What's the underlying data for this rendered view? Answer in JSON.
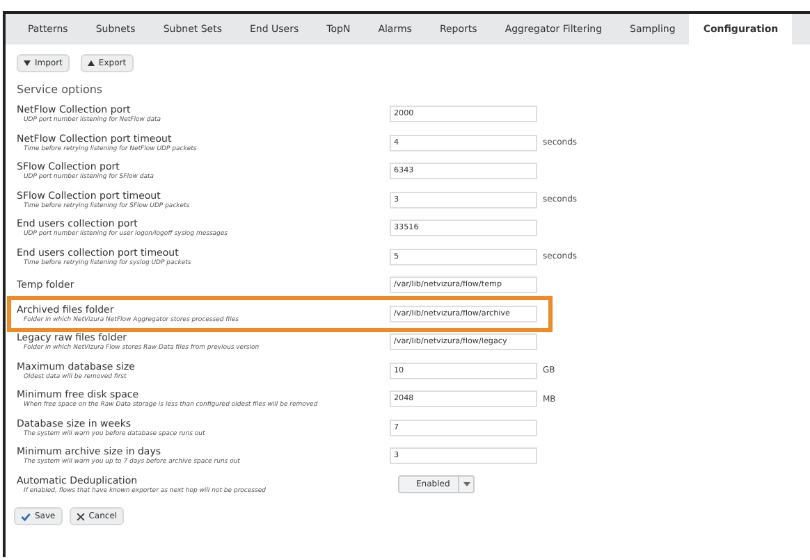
{
  "tabs": [
    {
      "label": "Patterns",
      "selected": false
    },
    {
      "label": "Subnets",
      "selected": false
    },
    {
      "label": "Subnet Sets",
      "selected": false
    },
    {
      "label": "End Users",
      "selected": false
    },
    {
      "label": "TopN",
      "selected": false
    },
    {
      "label": "Alarms",
      "selected": false
    },
    {
      "label": "Reports",
      "selected": false
    },
    {
      "label": "Aggregator Filtering",
      "selected": false
    },
    {
      "label": "Sampling",
      "selected": false
    },
    {
      "label": "Configuration",
      "selected": true
    }
  ],
  "toolbar": [
    {
      "label": "Import",
      "kind": "import"
    },
    {
      "label": "Export",
      "kind": "export"
    }
  ],
  "section_title": "Service options",
  "options": [
    {
      "kind": "text",
      "label": "NetFlow Collection port",
      "description": "UDP port number listening for NetFlow data",
      "value": "2000",
      "highlighted": false
    },
    {
      "kind": "text",
      "label": "NetFlow Collection port timeout",
      "description": "Time before retrying listening for NetFlow UDP packets",
      "value": "4",
      "unit": "seconds",
      "highlighted": false
    },
    {
      "kind": "text",
      "label": "SFlow Collection port",
      "description": "UDP port number listening for SFlow data",
      "value": "6343",
      "highlighted": false
    },
    {
      "kind": "text",
      "label": "SFlow Collection port timeout",
      "description": "Time before retrying listening for SFlow UDP packets",
      "value": "3",
      "unit": "seconds",
      "highlighted": false
    },
    {
      "kind": "text",
      "label": "End users collection port",
      "description": "UDP port number listening for user logon/logoff syslog messages",
      "value": "33516",
      "highlighted": false
    },
    {
      "kind": "text",
      "label": "End users collection port timeout",
      "description": "Time before retrying listening for syslog UDP packets",
      "value": "5",
      "unit": "seconds",
      "highlighted": false
    },
    {
      "kind": "text",
      "label": "Temp folder",
      "value": "/var/lib/netvizura/flow/temp",
      "highlighted": false
    },
    {
      "kind": "text",
      "label": "Archived files folder",
      "description": "Folder in which NetVizura NetFlow Aggregator stores processed files",
      "value": "/var/lib/netvizura/flow/archive",
      "highlighted": true
    },
    {
      "kind": "text",
      "label": "Legacy raw files folder",
      "description": "Folder in which NetVizura Flow stores Raw Data files from previous version",
      "value": "/var/lib/netvizura/flow/legacy",
      "highlighted": false
    },
    {
      "kind": "text",
      "label": "Maximum database size",
      "description": "Oldest data will be removed first",
      "value": "10",
      "unit": "GB",
      "highlighted": false
    },
    {
      "kind": "text",
      "label": "Minimum free disk space",
      "description": "When free space on the Raw Data storage is less than configured oldest files will be removed",
      "value": "2048",
      "unit": "MB",
      "highlighted": false
    },
    {
      "kind": "text",
      "label": "Database size in weeks",
      "description": "The system will warn you before database space runs out",
      "value": "7",
      "highlighted": false
    },
    {
      "kind": "text",
      "label": "Minimum archive size in days",
      "description": "The system will warn you up to 7 days before archive space runs out",
      "value": "3",
      "highlighted": false
    },
    {
      "kind": "select",
      "label": "Automatic Deduplication",
      "description": "If enabled, flows that have known exporter as next hop will not be processed",
      "value": "Enabled",
      "highlighted": false
    }
  ],
  "actions": [
    {
      "label": "Save",
      "kind": "save"
    },
    {
      "label": "Cancel",
      "kind": "cancel"
    }
  ]
}
